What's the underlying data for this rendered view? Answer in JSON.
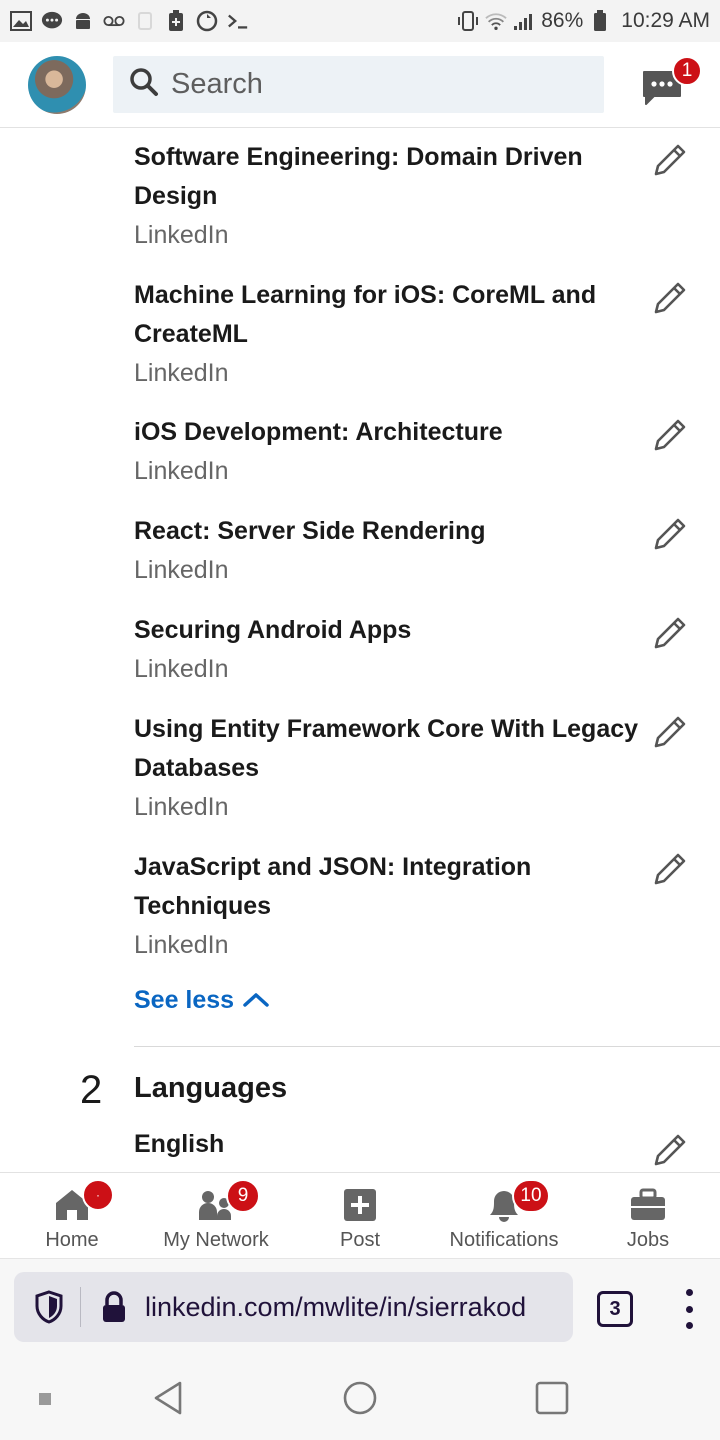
{
  "status_bar": {
    "battery": "86%",
    "time": "10:29 AM"
  },
  "header": {
    "search_placeholder": "Search",
    "messages_badge": "1"
  },
  "courses": [
    {
      "title": "Software Engineering: Domain Driven Design",
      "provider": "LinkedIn"
    },
    {
      "title": "Machine Learning for iOS: CoreML and CreateML",
      "provider": "LinkedIn"
    },
    {
      "title": "iOS Development: Architecture",
      "provider": "LinkedIn"
    },
    {
      "title": "React: Server Side Rendering",
      "provider": "LinkedIn"
    },
    {
      "title": "Securing Android Apps",
      "provider": "LinkedIn"
    },
    {
      "title": "Using Entity Framework Core With Legacy Databases",
      "provider": "LinkedIn"
    },
    {
      "title": "JavaScript and JSON: Integration Techniques",
      "provider": "LinkedIn"
    }
  ],
  "see_less": "See less",
  "languages": {
    "count": "2",
    "heading": "Languages",
    "items": [
      "English"
    ]
  },
  "bottom_nav": [
    {
      "label": "Home",
      "badge": ""
    },
    {
      "label": "My Network",
      "badge": "9"
    },
    {
      "label": "Post",
      "badge": ""
    },
    {
      "label": "Notifications",
      "badge": "10"
    },
    {
      "label": "Jobs",
      "badge": ""
    }
  ],
  "browser": {
    "url": "linkedin.com/mwlite/in/sierrakod",
    "tab_count": "3"
  },
  "colors": {
    "accent": "#0a66c2",
    "badge": "#cc1016"
  }
}
